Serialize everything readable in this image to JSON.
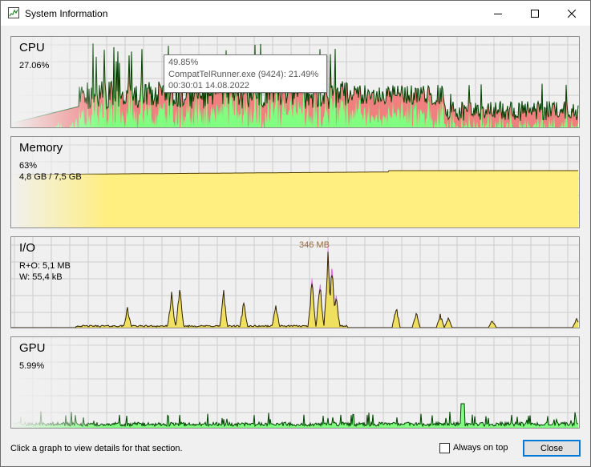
{
  "window": {
    "title": "System Information"
  },
  "panels": {
    "cpu": {
      "label": "CPU",
      "stat1": "27.06%",
      "fill_color": "#80ff80",
      "overlay_color": "#f08080",
      "line_color": "#004000"
    },
    "memory": {
      "label": "Memory",
      "stat1": "63%",
      "stat2": "4,8 GB / 7,5 GB",
      "fill_color": "#ffee80",
      "line_color": "#503c00"
    },
    "io": {
      "label": "I/O",
      "stat1": "R+O: 5,1 MB",
      "stat2": "W: 55,4 kB",
      "peak_label": "346 MB",
      "read_color": "#f0e060",
      "write_color": "#e070f0"
    },
    "gpu": {
      "label": "GPU",
      "stat1": "5.99%",
      "fill_color": "#80ff80"
    }
  },
  "tooltip": {
    "line1": "49.85%",
    "line2": "CompatTelRunner.exe (9424): 21.49%",
    "line3": "00:30:01 14.08.2022"
  },
  "footer": {
    "hint": "Click a graph to view details for that section.",
    "always_on_top_label": "Always on top",
    "always_on_top_checked": false,
    "close_label": "Close"
  },
  "icons": {
    "app": "system-information-icon",
    "minimize": "minimize-icon",
    "maximize": "maximize-icon",
    "close": "close-icon"
  }
}
